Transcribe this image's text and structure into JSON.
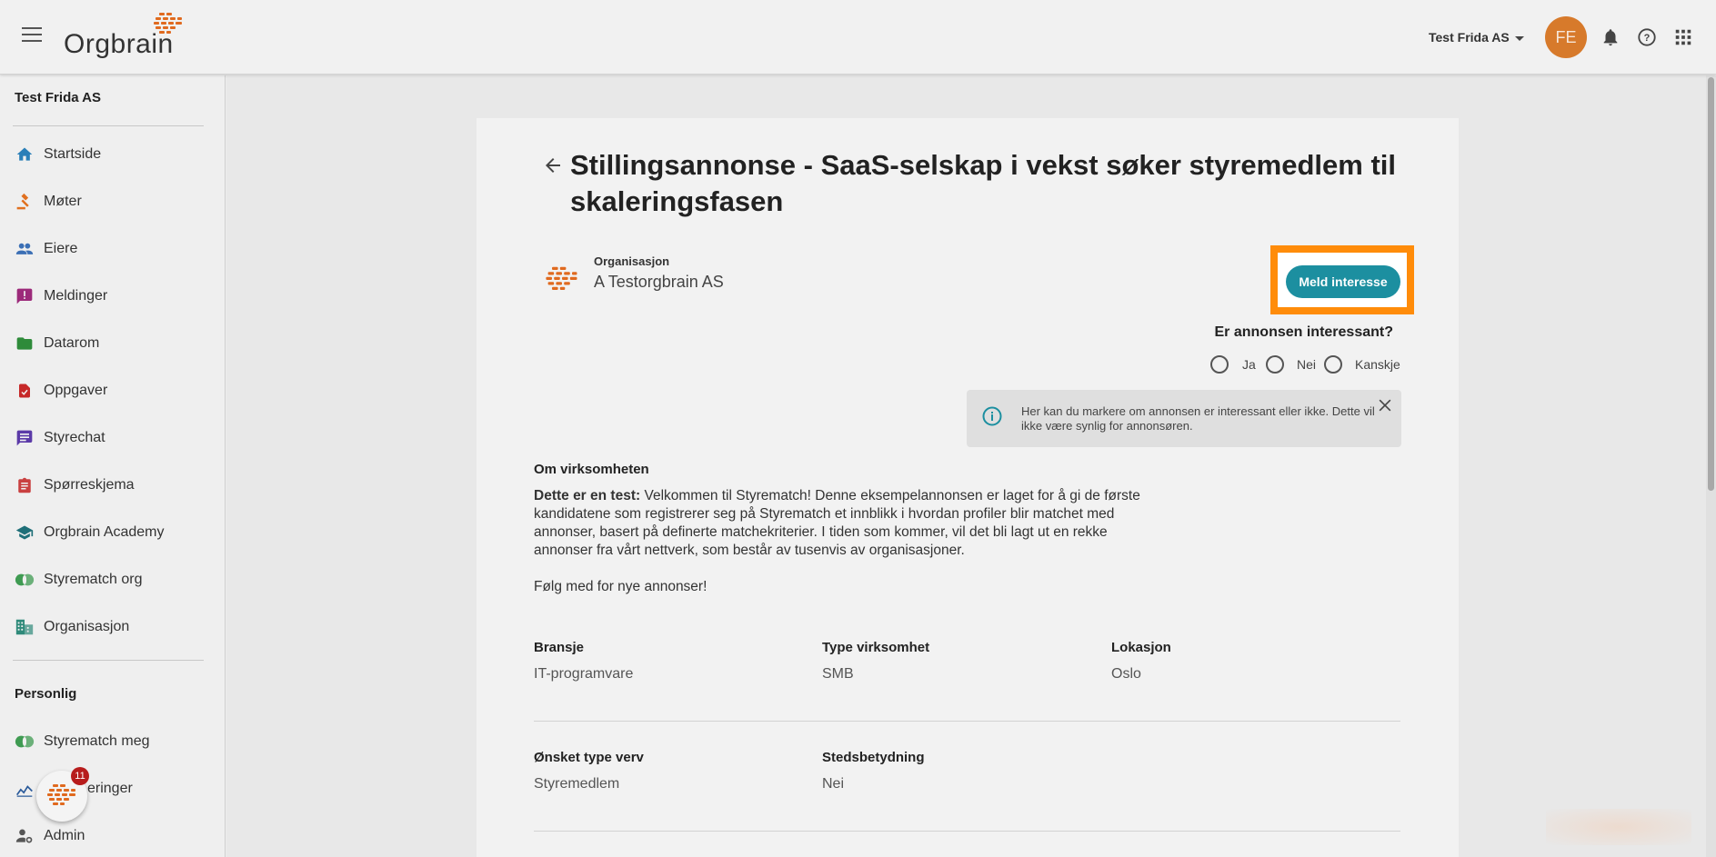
{
  "header": {
    "logo_text": "Orgbrain",
    "org_switch_label": "Test Frida AS",
    "avatar_initials": "FE"
  },
  "sidebar": {
    "org_name": "Test Frida AS",
    "items": [
      {
        "label": "Startside",
        "icon": "home-icon"
      },
      {
        "label": "Møter",
        "icon": "gavel-icon"
      },
      {
        "label": "Eiere",
        "icon": "people-icon"
      },
      {
        "label": "Meldinger",
        "icon": "message-alert-icon"
      },
      {
        "label": "Datarom",
        "icon": "folder-icon"
      },
      {
        "label": "Oppgaver",
        "icon": "task-icon"
      },
      {
        "label": "Styrechat",
        "icon": "chat-icon"
      },
      {
        "label": "Spørreskjema",
        "icon": "clipboard-icon"
      },
      {
        "label": "Orgbrain Academy",
        "icon": "school-icon"
      },
      {
        "label": "Styrematch org",
        "icon": "match-icon"
      },
      {
        "label": "Organisasjon",
        "icon": "organization-icon"
      }
    ],
    "personal_section": "Personlig",
    "personal_items": [
      {
        "label": "Styrematch meg",
        "icon": "match-icon"
      },
      {
        "label": "eringer",
        "icon": "chart-icon"
      },
      {
        "label": "Admin",
        "icon": "admin-icon"
      }
    ],
    "fab_badge": "11"
  },
  "main": {
    "title": "Stillingsannonse - SaaS-selskap i vekst søker styremedlem til skaleringsfasen",
    "org_label": "Organisasjon",
    "org_name": "A Testorgbrain AS",
    "interest_button": "Meld interesse",
    "question": "Er annonsen interessant?",
    "options": [
      "Ja",
      "Nei",
      "Kanskje"
    ],
    "info_text": "Her kan du markere om annonsen er interessant eller ikke. Dette vil ikke være synlig for annonsøren.",
    "about_title": "Om virksomheten",
    "desc_bold": "Dette er en test:",
    "desc_text": " Velkommen til Styrematch! Denne eksempelannonsen er laget for å gi de første kandidatene som registrerer seg på Styrematch et innblikk i hvordan profiler blir matchet med annonser, basert på definerte matchekriterier. I tiden som kommer, vil det bli lagt ut en rekke annonser fra vårt nettverk, som består av tusenvis av organisasjoner.",
    "desc_follow": "Følg med for nye annonser!",
    "fields_row1": [
      {
        "label": "Bransje",
        "value": "IT-programvare"
      },
      {
        "label": "Type virksomhet",
        "value": "SMB"
      },
      {
        "label": "Lokasjon",
        "value": "Oslo"
      }
    ],
    "fields_row2": [
      {
        "label": "Ønsket type verv",
        "value": "Styremedlem"
      },
      {
        "label": "Stedsbetydning",
        "value": "Nei"
      }
    ]
  },
  "colors": {
    "accent": "#1c8fa0",
    "highlight": "#ff8c0a",
    "avatar": "#d77a2b",
    "logo_orange": "#e06a1f"
  }
}
